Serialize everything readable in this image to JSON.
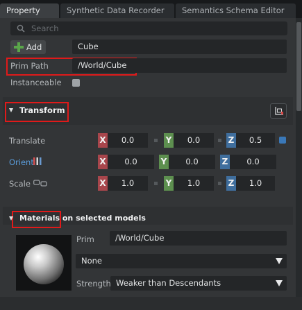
{
  "tabs": [
    {
      "label": "Property",
      "active": true
    },
    {
      "label": "Synthetic Data Recorder",
      "active": false
    },
    {
      "label": "Semantics Schema Editor",
      "active": false
    }
  ],
  "search": {
    "placeholder": "Search"
  },
  "add_button": {
    "label": "Add",
    "icon": "plus-icon"
  },
  "prim_name": "Cube",
  "prim_path": {
    "label": "Prim Path",
    "value": "/World/Cube"
  },
  "instanceable": {
    "label": "Instanceable",
    "checked": false
  },
  "transform": {
    "title": "Transform",
    "translate": {
      "label": "Translate",
      "x": "0.0",
      "y": "0.0",
      "z": "0.5"
    },
    "orient": {
      "label": "Orient",
      "x": "0.0",
      "y": "0.0",
      "z": "0.0"
    },
    "scale": {
      "label": "Scale",
      "x": "1.0",
      "y": "1.0",
      "z": "1.0"
    },
    "axis_letters": {
      "x": "X",
      "y": "Y",
      "z": "Z"
    }
  },
  "materials": {
    "title": "Materials on selected models",
    "prim_label": "Prim",
    "prim_value": "/World/Cube",
    "material_value": "None",
    "strength_label": "Strength",
    "strength_value": "Weaker than Descendants"
  },
  "colors": {
    "highlight": "#e01a1a",
    "axis_x": "#a8464c",
    "axis_y": "#5d8f4f",
    "axis_z": "#3f6e9d",
    "add_plus": "#5aa64a",
    "orient_label": "#5a9bd8"
  }
}
